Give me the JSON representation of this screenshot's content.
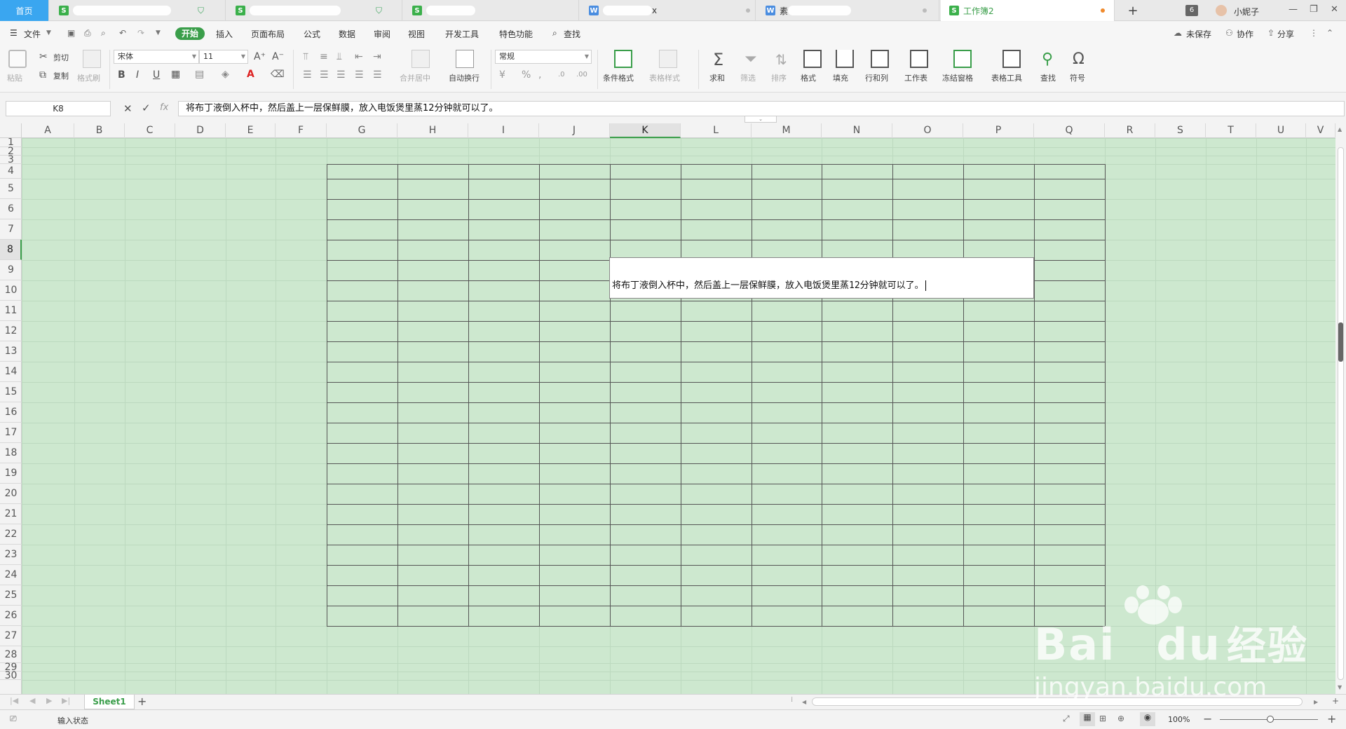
{
  "tabs": {
    "home": "首页",
    "doc1_suffix": "",
    "doc4_suffix": "x",
    "doc5_prefix": "素",
    "active": "工作簿2",
    "new_tab": "+",
    "window_count": "6",
    "user": "小妮子",
    "window_controls": [
      "—",
      "❐",
      "✕"
    ]
  },
  "menu": {
    "file": "文件",
    "items": [
      "开始",
      "插入",
      "页面布局",
      "公式",
      "数据",
      "审阅",
      "视图",
      "开发工具",
      "特色功能"
    ],
    "search": "查找",
    "unsaved": "未保存",
    "collab": "协作",
    "share": "分享"
  },
  "ribbon": {
    "paste": "粘贴",
    "cut": "剪切",
    "copy": "复制",
    "format_painter": "格式刷",
    "font_name": "宋体",
    "font_size": "11",
    "merge_center": "合并居中",
    "wrap_text": "自动换行",
    "number_format": "常规",
    "cond_format": "条件格式",
    "table_style": "表格样式",
    "sum": "求和",
    "filter": "筛选",
    "sort": "排序",
    "format": "格式",
    "fill": "填充",
    "row_col": "行和列",
    "worksheet": "工作表",
    "freeze": "冻结窗格",
    "table_tools": "表格工具",
    "find": "查找",
    "symbol": "符号",
    "bold": "B",
    "italic": "I",
    "underline": "U",
    "font_color": "A",
    "grow_font": "A⁺",
    "shrink_font": "A⁻",
    "percent": "%"
  },
  "formula_bar": {
    "name_box": "K8",
    "fx": "fx",
    "content": "将布丁液倒入杯中，然后盖上一层保鲜膜，放入电饭煲里蒸12分钟就可以了。"
  },
  "grid": {
    "columns": [
      "A",
      "B",
      "C",
      "D",
      "E",
      "F",
      "G",
      "H",
      "I",
      "J",
      "K",
      "L",
      "M",
      "N",
      "O",
      "P",
      "Q",
      "R",
      "S",
      "T",
      "U",
      "V"
    ],
    "rows": [
      "1",
      "2",
      "3",
      "4",
      "5",
      "6",
      "7",
      "8",
      "9",
      "10",
      "11",
      "12",
      "13",
      "14",
      "15",
      "16",
      "17",
      "18",
      "19",
      "20",
      "21",
      "22",
      "23",
      "24",
      "25",
      "26",
      "27",
      "28",
      "29",
      "30"
    ],
    "active_col": "K",
    "active_row": "8",
    "edit_text": "将布丁液倒入杯中，然后盖上一层保鲜膜，放入电饭煲里蒸12分钟就可以了。",
    "background_color": "#cde8cf"
  },
  "sheets": {
    "names": [
      "Sheet1"
    ],
    "add": "+"
  },
  "status": {
    "mode": "输入状态",
    "zoom": "100%",
    "zoom_minus": "−",
    "zoom_plus": "+"
  },
  "watermark": {
    "brand": "Bai",
    "brand2": "du",
    "cn": "经验",
    "url": "jingyan.baidu.com"
  }
}
